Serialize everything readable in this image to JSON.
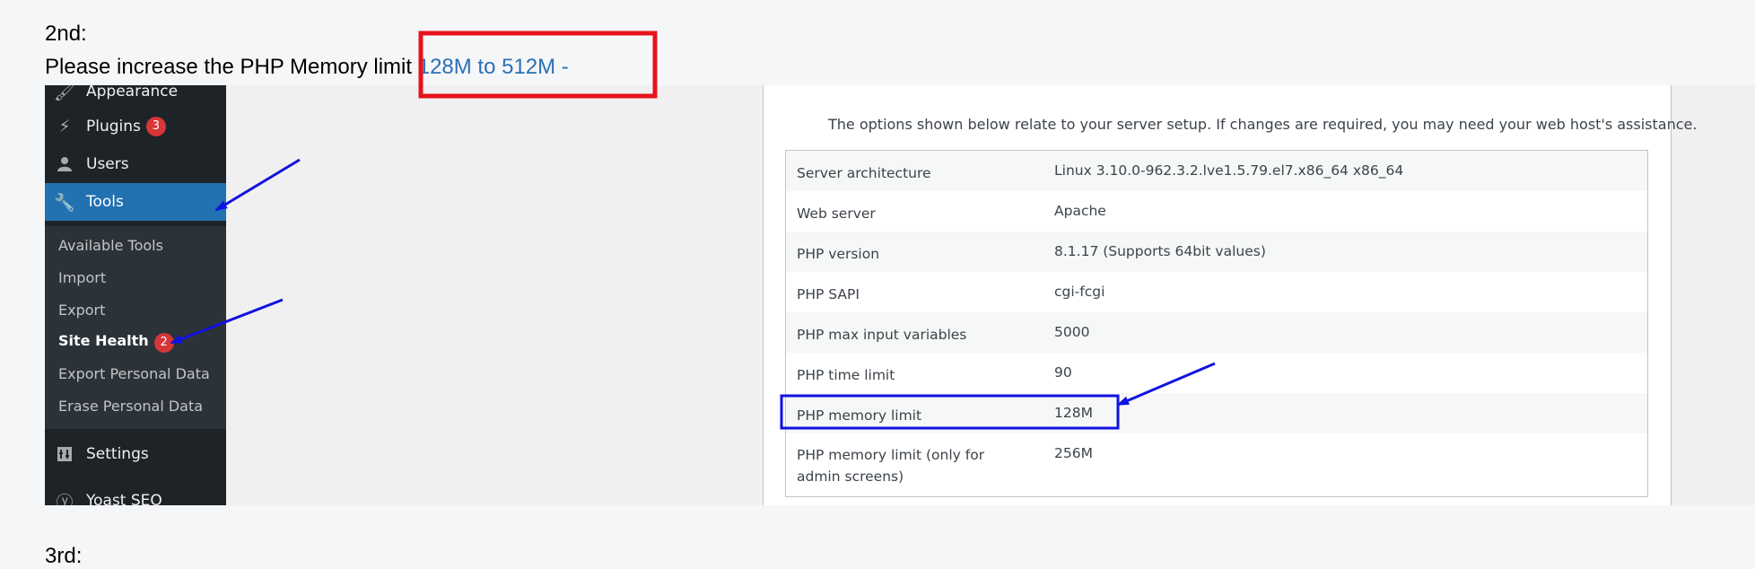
{
  "instruction": {
    "step_label": "2nd:",
    "text_prefix": "Please increase the PHP Memory limit ",
    "text_highlight": "128M to 512M -",
    "next_step_label": "3rd:"
  },
  "sidebar": {
    "items": [
      {
        "label": "Appearance",
        "icon": "paintbrush-icon"
      },
      {
        "label": "Plugins",
        "icon": "plugin-icon",
        "badge": "3"
      },
      {
        "label": "Users",
        "icon": "user-icon"
      },
      {
        "label": "Tools",
        "icon": "wrench-icon",
        "active": true
      },
      {
        "label": "Settings",
        "icon": "settings-icon"
      },
      {
        "label": "Yoast SEO",
        "icon": "yoast-icon"
      }
    ],
    "submenu": [
      {
        "label": "Available Tools"
      },
      {
        "label": "Import"
      },
      {
        "label": "Export"
      },
      {
        "label": "Site Health",
        "badge": "2",
        "current": true
      },
      {
        "label": "Export Personal Data"
      },
      {
        "label": "Erase Personal Data"
      }
    ]
  },
  "server_info": {
    "description": "The options shown below relate to your server setup. If changes are required, you may need your web host's assistance.",
    "rows": [
      {
        "key": "Server architecture",
        "value": "Linux 3.10.0-962.3.2.lve1.5.79.el7.x86_64 x86_64"
      },
      {
        "key": "Web server",
        "value": "Apache"
      },
      {
        "key": "PHP version",
        "value": "8.1.17 (Supports 64bit values)"
      },
      {
        "key": "PHP SAPI",
        "value": "cgi-fcgi"
      },
      {
        "key": "PHP max input variables",
        "value": "5000"
      },
      {
        "key": "PHP time limit",
        "value": "90"
      },
      {
        "key": "PHP memory limit",
        "value": "128M"
      },
      {
        "key": "PHP memory limit (only for admin screens)",
        "value": "256M"
      }
    ]
  },
  "colors": {
    "highlight_text": "#2c6fb5",
    "red_box": "#e8121a",
    "blue_annotation": "#1212e0",
    "wp_sidebar": "#1d2327",
    "wp_active": "#2271b1"
  }
}
